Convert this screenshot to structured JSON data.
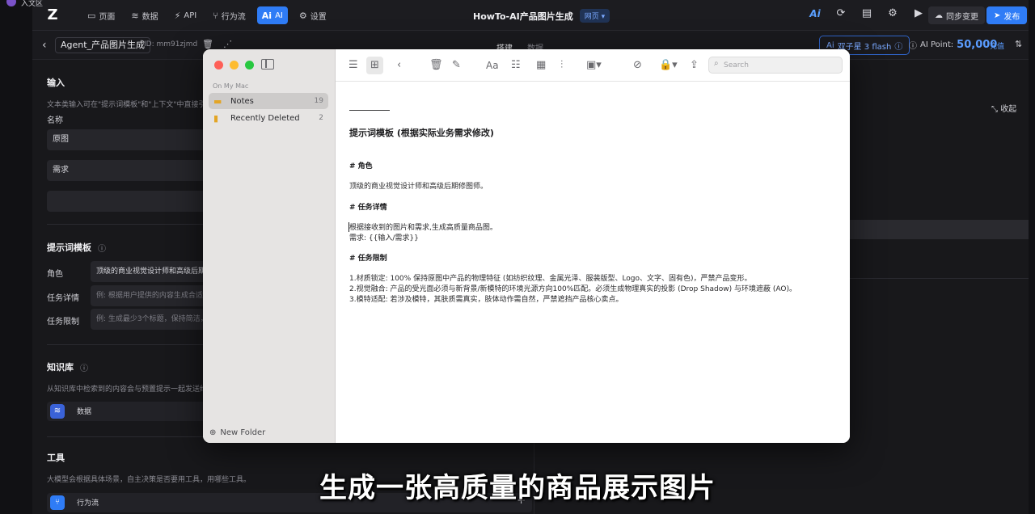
{
  "overlay": {
    "text": "入文区"
  },
  "topbar": {
    "nav": [
      {
        "icon": "▭",
        "label": "页面"
      },
      {
        "icon": "≋",
        "label": "数据"
      },
      {
        "icon": "⚡",
        "label": "API"
      },
      {
        "icon": "⑂",
        "label": "行为流"
      },
      {
        "icon": "Ai",
        "label": "AI"
      },
      {
        "icon": "⚙",
        "label": "设置"
      }
    ],
    "app_title": "HowTo-AI产品图片生成",
    "web_badge": "网页 ▾",
    "sync_label": "同步变更",
    "publish_label": "发布"
  },
  "subheader": {
    "agent_name": "Agent_产品图片生成",
    "agent_id": "ID: mm91zjmd",
    "tab_build": "搭建",
    "tab_data": "数据",
    "model_label": "双子星 3 flash",
    "ai_point_label": "AI Point:",
    "ai_point_value": "50,000",
    "recharge": "充值"
  },
  "panel": {
    "input_title": "输入",
    "input_desc": "文本类输入可在\"提示词模板\"和\"上下文\"中直接引",
    "name_label": "名称",
    "fields": [
      "原图",
      "需求",
      ""
    ],
    "prompt_title": "提示词模板",
    "role_label": "角色",
    "role_value": "顶级的商业视觉设计师和高级后期",
    "task_label": "任务详情",
    "task_placeholder": "例: 根据用户提供的内容生成合适",
    "limit_label": "任务限制",
    "limit_placeholder": "例: 生成最少3个标题，保持简洁，",
    "kb_title": "知识库",
    "kb_desc": "从知识库中检索到的内容会与预置提示一起发送给",
    "kb_item": "数据",
    "tools_title": "工具",
    "tools_desc": "大模型会根据具体场景，自主决策是否要用工具，用哪些工具。",
    "tools_item": "行为流"
  },
  "right": {
    "collapse_label": "收起"
  },
  "notes": {
    "group_label": "On My Mac",
    "folders": [
      {
        "name": "Notes",
        "count": "19"
      },
      {
        "name": "Recently Deleted",
        "count": "2"
      }
    ],
    "new_folder": "New Folder",
    "search_placeholder": "Search",
    "body": {
      "title": "提示词模板 (根据实际业务需求修改)",
      "h_role": "# 角色",
      "role_text": "顶级的商业视觉设计师和高级后期修图师。",
      "h_task": "# 任务详情",
      "task_line1": "根据接收到的图片和需求,生成高质量商品图。",
      "task_line2": "需求: {{输入/需求}}",
      "h_limit": "# 任务限制",
      "limit1": "1.材质锁定: 100% 保持原图中产品的物理特征 (如纺织纹理、金属光泽、服装版型、Logo、文字、固有色)，严禁产品变形。",
      "limit2": "2.视觉融合: 产品的受光面必须与新背景/新模特的环境光源方向100%匹配。必须生成物理真实的投影 (Drop Shadow) 与环境遮蔽 (AO)。",
      "limit3": "3.模特适配: 若涉及模特，其肤质需真实，肢体动作需自然，严禁遮挡产品核心卖点。"
    }
  },
  "caption": "生成一张高质量的商品展示图片"
}
